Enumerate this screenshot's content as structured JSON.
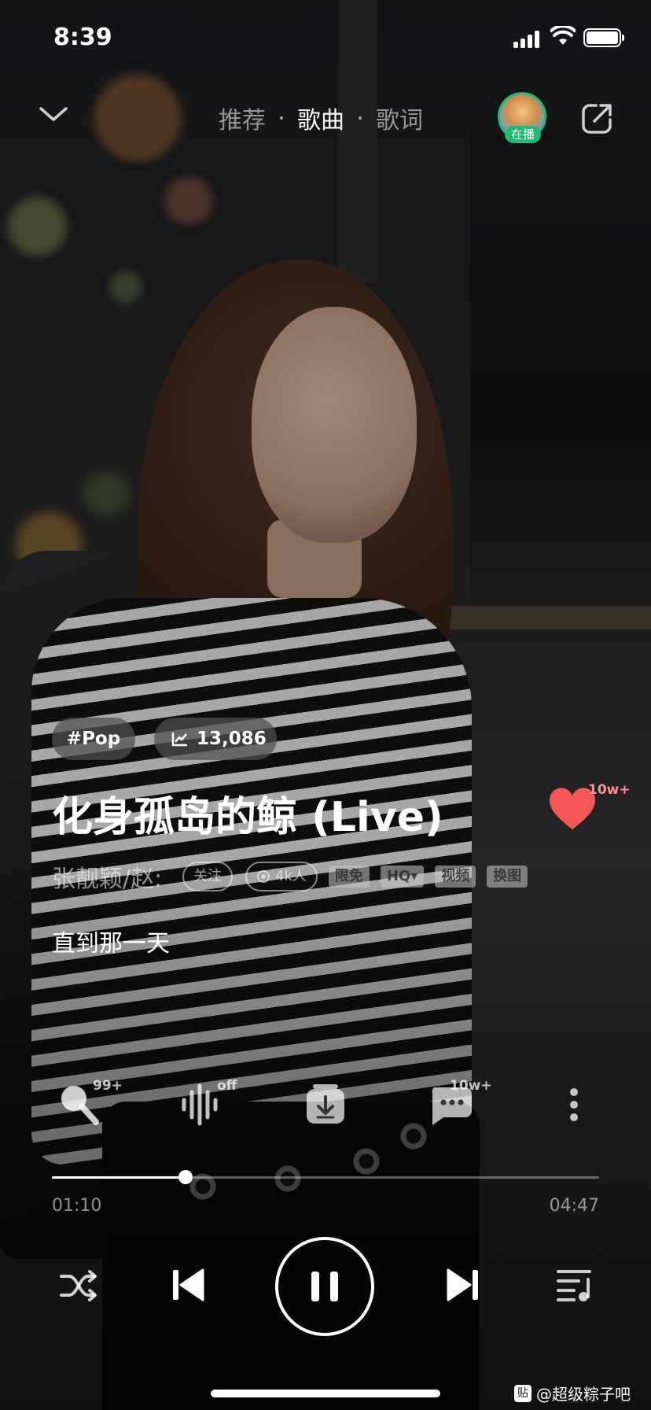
{
  "status_bar": {
    "time": "8:39"
  },
  "header": {
    "tabs": [
      {
        "label": "推荐",
        "active": false
      },
      {
        "label": "歌曲",
        "active": true
      },
      {
        "label": "歌词",
        "active": false
      }
    ],
    "on_air_badge": "在播"
  },
  "song": {
    "genre_tag": "#Pop",
    "play_count": "13,086",
    "title": "化身孤岛的鲸 (Live)",
    "likes": "10w+",
    "artist": "张靓颖/赵:",
    "follow_label": "关注",
    "listeners": "4k人",
    "tags": [
      "限免",
      "HQ▾",
      "视频",
      "换图"
    ],
    "lyric_line": "直到那一天"
  },
  "actions": {
    "sing_count": "99+",
    "effect_state": "off",
    "comment_count": "10w+"
  },
  "progress": {
    "current": "01:10",
    "total": "04:47",
    "fraction": 0.244
  },
  "watermark": {
    "icon": "贴",
    "text": "@超级粽子吧"
  },
  "colors": {
    "accent_green": "#1db874",
    "heart_red": "#f55656"
  }
}
